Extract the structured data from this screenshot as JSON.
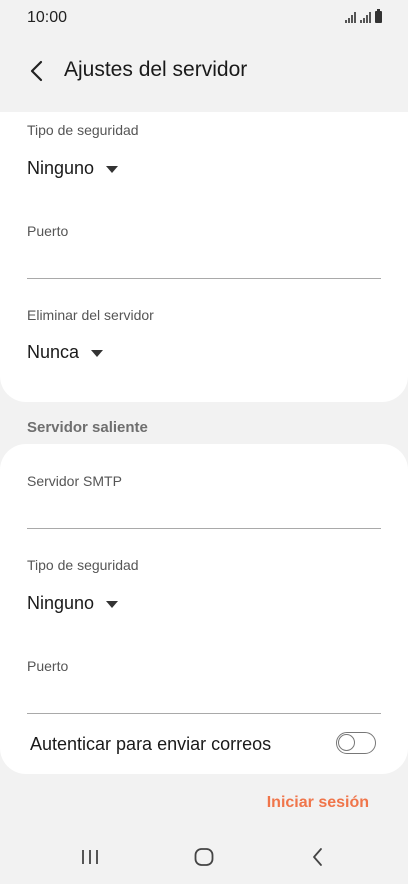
{
  "status_bar": {
    "time": "10:00",
    "icons": [
      "signal-icon",
      "signal-icon",
      "battery-icon"
    ]
  },
  "header": {
    "back_icon": "back-arrow-icon",
    "title": "Ajustes del servidor"
  },
  "incoming": {
    "security_type": {
      "label": "Tipo de seguridad",
      "value": "Ninguno"
    },
    "port": {
      "label": "Puerto",
      "value": ""
    },
    "delete_from_server": {
      "label": "Eliminar del servidor",
      "value": "Nunca"
    }
  },
  "outgoing": {
    "section_title": "Servidor saliente",
    "smtp_server": {
      "label": "Servidor SMTP",
      "value": ""
    },
    "security_type": {
      "label": "Tipo de seguridad",
      "value": "Ninguno"
    },
    "port": {
      "label": "Puerto",
      "value": ""
    },
    "authenticate": {
      "label": "Autenticar para enviar correos",
      "enabled": false
    }
  },
  "actions": {
    "sign_in": "Iniciar sesión"
  },
  "nav_bar": {
    "buttons": [
      "recent-apps-icon",
      "home-icon",
      "back-icon"
    ]
  },
  "colors": {
    "accent": "#f0754a",
    "background": "#f2f2f2",
    "card": "#ffffff"
  }
}
